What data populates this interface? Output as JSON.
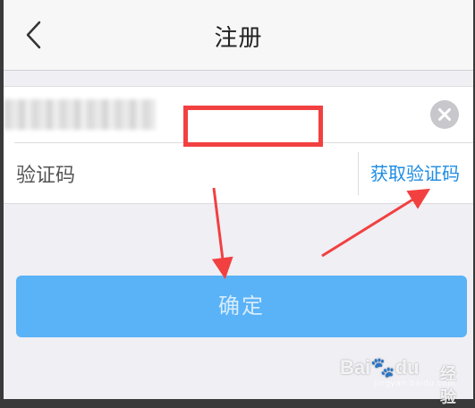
{
  "navbar": {
    "title": "注册",
    "back_icon": "chevron-left-icon"
  },
  "form": {
    "phone": {
      "value_state": "blurred",
      "clear_icon": "close-circle-icon"
    },
    "code": {
      "label": "验证码",
      "value": "",
      "get_code_label": "获取验证码"
    }
  },
  "confirm": {
    "label": "确定",
    "enabled": false
  },
  "annotations": {
    "highlight_color": "#f24040",
    "arrow_color": "#f24040"
  },
  "watermark": {
    "brand": "Bai",
    "brand_suffix": "du",
    "product": "经验",
    "url": "jingyan.baidu.com"
  },
  "colors": {
    "accent": "#1e8ce4",
    "button": "#5ab2f7",
    "background": "#efeff4"
  }
}
